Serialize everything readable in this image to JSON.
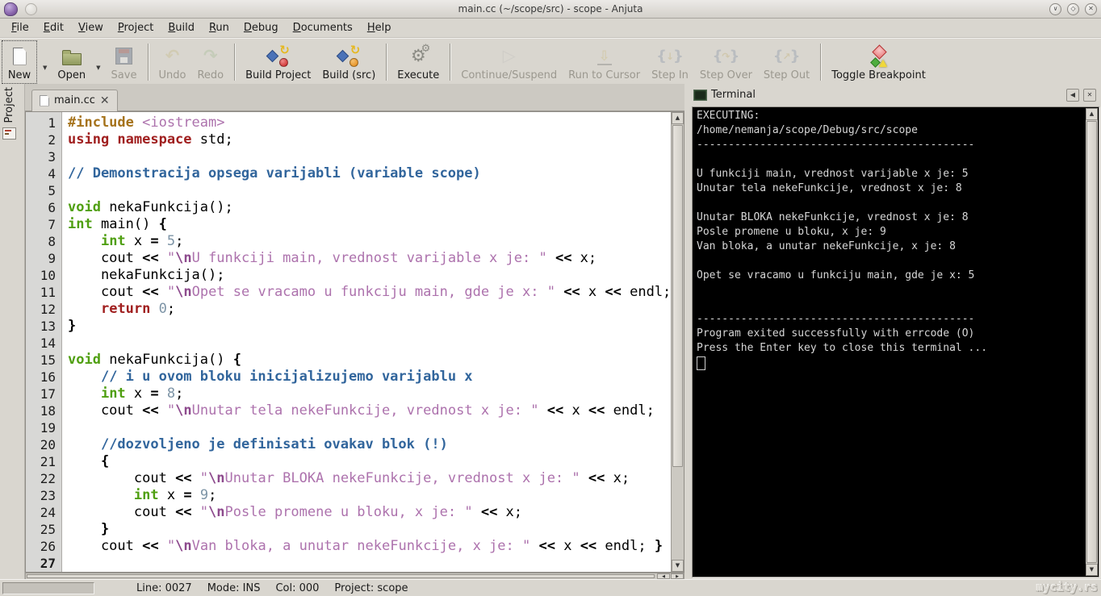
{
  "window": {
    "title": "main.cc (~/scope/src) - scope - Anjuta"
  },
  "icons": {
    "minimize": "∨",
    "maximize": "◇",
    "close": "✕",
    "tab_close": "✕",
    "dropdown": "▼",
    "scroll_up": "▲",
    "scroll_down": "▼",
    "scroll_left": "◀",
    "scroll_right": "▶",
    "term_dock": "◀",
    "term_close": "✕"
  },
  "menubar": {
    "items": [
      "File",
      "Edit",
      "View",
      "Project",
      "Build",
      "Run",
      "Debug",
      "Documents",
      "Help"
    ]
  },
  "toolbar": {
    "items": [
      {
        "type": "button",
        "label": "New",
        "icon": "new",
        "enabled": true,
        "dropdown": true,
        "focused": true
      },
      {
        "type": "button",
        "label": "Open",
        "icon": "open",
        "enabled": true,
        "dropdown": true
      },
      {
        "type": "button",
        "label": "Save",
        "icon": "save",
        "enabled": false
      },
      {
        "type": "sep"
      },
      {
        "type": "button",
        "label": "Undo",
        "icon": "undo",
        "enabled": false
      },
      {
        "type": "button",
        "label": "Redo",
        "icon": "redo",
        "enabled": false
      },
      {
        "type": "sep"
      },
      {
        "type": "button",
        "label": "Build Project",
        "icon": "build-project",
        "enabled": true
      },
      {
        "type": "button",
        "label": "Build (src)",
        "icon": "build-src",
        "enabled": true
      },
      {
        "type": "sep"
      },
      {
        "type": "button",
        "label": "Execute",
        "icon": "execute",
        "enabled": true
      },
      {
        "type": "sep"
      },
      {
        "type": "button",
        "label": "Continue/Suspend",
        "icon": "continue",
        "enabled": false
      },
      {
        "type": "button",
        "label": "Run to Cursor",
        "icon": "run-to-cursor",
        "enabled": false
      },
      {
        "type": "button",
        "label": "Step In",
        "icon": "step-in",
        "enabled": false
      },
      {
        "type": "button",
        "label": "Step Over",
        "icon": "step-over",
        "enabled": false
      },
      {
        "type": "button",
        "label": "Step Out",
        "icon": "step-out",
        "enabled": false
      },
      {
        "type": "sep"
      },
      {
        "type": "button",
        "label": "Toggle Breakpoint",
        "icon": "toggle-breakpoint",
        "enabled": true
      }
    ]
  },
  "sidebar": {
    "tab_label": "Project"
  },
  "editor": {
    "tab": {
      "label": "main.cc"
    },
    "current_line": 27,
    "lines": [
      {
        "n": 1,
        "tokens": [
          {
            "t": "#include ",
            "c": "pre"
          },
          {
            "t": "<iostream>",
            "c": "str"
          }
        ]
      },
      {
        "n": 2,
        "tokens": [
          {
            "t": "using namespace",
            "c": "kw"
          },
          {
            "t": " std;",
            "c": "pl"
          }
        ]
      },
      {
        "n": 3,
        "tokens": []
      },
      {
        "n": 4,
        "tokens": [
          {
            "t": "// Demonstracija opsega varijabli (variable scope)",
            "c": "com"
          }
        ]
      },
      {
        "n": 5,
        "tokens": []
      },
      {
        "n": 6,
        "tokens": [
          {
            "t": "void",
            "c": "type"
          },
          {
            "t": " nekaFunkcija();",
            "c": "pl"
          }
        ]
      },
      {
        "n": 7,
        "tokens": [
          {
            "t": "int",
            "c": "type"
          },
          {
            "t": " main() ",
            "c": "pl"
          },
          {
            "t": "{",
            "c": "op"
          }
        ]
      },
      {
        "n": 8,
        "tokens": [
          {
            "t": "    ",
            "c": "pl"
          },
          {
            "t": "int",
            "c": "type"
          },
          {
            "t": " x ",
            "c": "pl"
          },
          {
            "t": "=",
            "c": "op"
          },
          {
            "t": " ",
            "c": "pl"
          },
          {
            "t": "5",
            "c": "num"
          },
          {
            "t": ";",
            "c": "pl"
          }
        ]
      },
      {
        "n": 9,
        "tokens": [
          {
            "t": "    cout ",
            "c": "pl"
          },
          {
            "t": "<<",
            "c": "op"
          },
          {
            "t": " ",
            "c": "pl"
          },
          {
            "t": "\"",
            "c": "str"
          },
          {
            "t": "\\n",
            "c": "esc"
          },
          {
            "t": "U funkciji main, vrednost varijable x je: \"",
            "c": "str"
          },
          {
            "t": " ",
            "c": "pl"
          },
          {
            "t": "<<",
            "c": "op"
          },
          {
            "t": " x;",
            "c": "pl"
          }
        ]
      },
      {
        "n": 10,
        "tokens": [
          {
            "t": "    nekaFunkcija();",
            "c": "pl"
          }
        ]
      },
      {
        "n": 11,
        "tokens": [
          {
            "t": "    cout ",
            "c": "pl"
          },
          {
            "t": "<<",
            "c": "op"
          },
          {
            "t": " ",
            "c": "pl"
          },
          {
            "t": "\"",
            "c": "str"
          },
          {
            "t": "\\n",
            "c": "esc"
          },
          {
            "t": "Opet se vracamo u funkciju main, gde je x: \"",
            "c": "str"
          },
          {
            "t": " ",
            "c": "pl"
          },
          {
            "t": "<<",
            "c": "op"
          },
          {
            "t": " x ",
            "c": "pl"
          },
          {
            "t": "<<",
            "c": "op"
          },
          {
            "t": " endl;",
            "c": "pl"
          }
        ]
      },
      {
        "n": 12,
        "tokens": [
          {
            "t": "    ",
            "c": "pl"
          },
          {
            "t": "return",
            "c": "kw"
          },
          {
            "t": " ",
            "c": "pl"
          },
          {
            "t": "0",
            "c": "num"
          },
          {
            "t": ";",
            "c": "pl"
          }
        ]
      },
      {
        "n": 13,
        "tokens": [
          {
            "t": "}",
            "c": "op"
          }
        ]
      },
      {
        "n": 14,
        "tokens": []
      },
      {
        "n": 15,
        "tokens": [
          {
            "t": "void",
            "c": "type"
          },
          {
            "t": " nekaFunkcija() ",
            "c": "pl"
          },
          {
            "t": "{",
            "c": "op"
          }
        ]
      },
      {
        "n": 16,
        "tokens": [
          {
            "t": "    ",
            "c": "pl"
          },
          {
            "t": "// i u ovom bloku inicijalizujemo varijablu x",
            "c": "com"
          }
        ]
      },
      {
        "n": 17,
        "tokens": [
          {
            "t": "    ",
            "c": "pl"
          },
          {
            "t": "int",
            "c": "type"
          },
          {
            "t": " x ",
            "c": "pl"
          },
          {
            "t": "=",
            "c": "op"
          },
          {
            "t": " ",
            "c": "pl"
          },
          {
            "t": "8",
            "c": "num"
          },
          {
            "t": ";",
            "c": "pl"
          }
        ]
      },
      {
        "n": 18,
        "tokens": [
          {
            "t": "    cout ",
            "c": "pl"
          },
          {
            "t": "<<",
            "c": "op"
          },
          {
            "t": " ",
            "c": "pl"
          },
          {
            "t": "\"",
            "c": "str"
          },
          {
            "t": "\\n",
            "c": "esc"
          },
          {
            "t": "Unutar tela nekeFunkcije, vrednost x je: \"",
            "c": "str"
          },
          {
            "t": " ",
            "c": "pl"
          },
          {
            "t": "<<",
            "c": "op"
          },
          {
            "t": " x ",
            "c": "pl"
          },
          {
            "t": "<<",
            "c": "op"
          },
          {
            "t": " endl;",
            "c": "pl"
          }
        ]
      },
      {
        "n": 19,
        "tokens": []
      },
      {
        "n": 20,
        "tokens": [
          {
            "t": "    ",
            "c": "pl"
          },
          {
            "t": "//dozvoljeno je definisati ovakav blok (!)",
            "c": "com"
          }
        ]
      },
      {
        "n": 21,
        "tokens": [
          {
            "t": "    ",
            "c": "pl"
          },
          {
            "t": "{",
            "c": "op"
          }
        ]
      },
      {
        "n": 22,
        "tokens": [
          {
            "t": "        cout ",
            "c": "pl"
          },
          {
            "t": "<<",
            "c": "op"
          },
          {
            "t": " ",
            "c": "pl"
          },
          {
            "t": "\"",
            "c": "str"
          },
          {
            "t": "\\n",
            "c": "esc"
          },
          {
            "t": "Unutar BLOKA nekeFunkcije, vrednost x je: \"",
            "c": "str"
          },
          {
            "t": " ",
            "c": "pl"
          },
          {
            "t": "<<",
            "c": "op"
          },
          {
            "t": " x;",
            "c": "pl"
          }
        ]
      },
      {
        "n": 23,
        "tokens": [
          {
            "t": "        ",
            "c": "pl"
          },
          {
            "t": "int",
            "c": "type"
          },
          {
            "t": " x ",
            "c": "pl"
          },
          {
            "t": "=",
            "c": "op"
          },
          {
            "t": " ",
            "c": "pl"
          },
          {
            "t": "9",
            "c": "num"
          },
          {
            "t": ";",
            "c": "pl"
          }
        ]
      },
      {
        "n": 24,
        "tokens": [
          {
            "t": "        cout ",
            "c": "pl"
          },
          {
            "t": "<<",
            "c": "op"
          },
          {
            "t": " ",
            "c": "pl"
          },
          {
            "t": "\"",
            "c": "str"
          },
          {
            "t": "\\n",
            "c": "esc"
          },
          {
            "t": "Posle promene u bloku, x je: \"",
            "c": "str"
          },
          {
            "t": " ",
            "c": "pl"
          },
          {
            "t": "<<",
            "c": "op"
          },
          {
            "t": " x;",
            "c": "pl"
          }
        ]
      },
      {
        "n": 25,
        "tokens": [
          {
            "t": "    ",
            "c": "pl"
          },
          {
            "t": "}",
            "c": "op"
          }
        ]
      },
      {
        "n": 26,
        "tokens": [
          {
            "t": "    cout ",
            "c": "pl"
          },
          {
            "t": "<<",
            "c": "op"
          },
          {
            "t": " ",
            "c": "pl"
          },
          {
            "t": "\"",
            "c": "str"
          },
          {
            "t": "\\n",
            "c": "esc"
          },
          {
            "t": "Van bloka, a unutar nekeFunkcije, x je: \"",
            "c": "str"
          },
          {
            "t": " ",
            "c": "pl"
          },
          {
            "t": "<<",
            "c": "op"
          },
          {
            "t": " x ",
            "c": "pl"
          },
          {
            "t": "<<",
            "c": "op"
          },
          {
            "t": " endl; ",
            "c": "pl"
          },
          {
            "t": "}",
            "c": "op"
          }
        ]
      },
      {
        "n": 27,
        "tokens": []
      }
    ]
  },
  "terminal": {
    "title": "Terminal",
    "cursor_visible": true,
    "lines": [
      "EXECUTING:",
      "/home/nemanja/scope/Debug/src/scope",
      "--------------------------------------------",
      "",
      "U funkciji main, vrednost varijable x je: 5",
      "Unutar tela nekeFunkcije, vrednost x je: 8",
      "",
      "Unutar BLOKA nekeFunkcije, vrednost x je: 8",
      "Posle promene u bloku, x je: 9",
      "Van bloka, a unutar nekeFunkcije, x je: 8",
      "",
      "Opet se vracamo u funkciju main, gde je x: 5",
      "",
      "",
      "--------------------------------------------",
      "Program exited successfully with errcode (O)",
      "Press the Enter key to close this terminal ..."
    ]
  },
  "statusbar": {
    "line": "Line: 0027",
    "mode": "Mode: INS",
    "col": "Col: 000",
    "project": "Project: scope",
    "watermark": "mycity.rs"
  },
  "colors": {
    "chrome": "#d9d6cf",
    "preprocessor": "#a5721a",
    "keyword": "#a01f1f",
    "type_keyword": "#4f9f10",
    "comment": "#31659c",
    "string": "#ad72ad",
    "escape": "#8d4a8d",
    "number": "#7d94a6",
    "terminal_bg": "#000000",
    "terminal_fg": "#d6d6d6",
    "breakpoint_red": "#e87878",
    "build_ball_red": "#c81e1e",
    "build_ball_orange": "#e2860f"
  }
}
